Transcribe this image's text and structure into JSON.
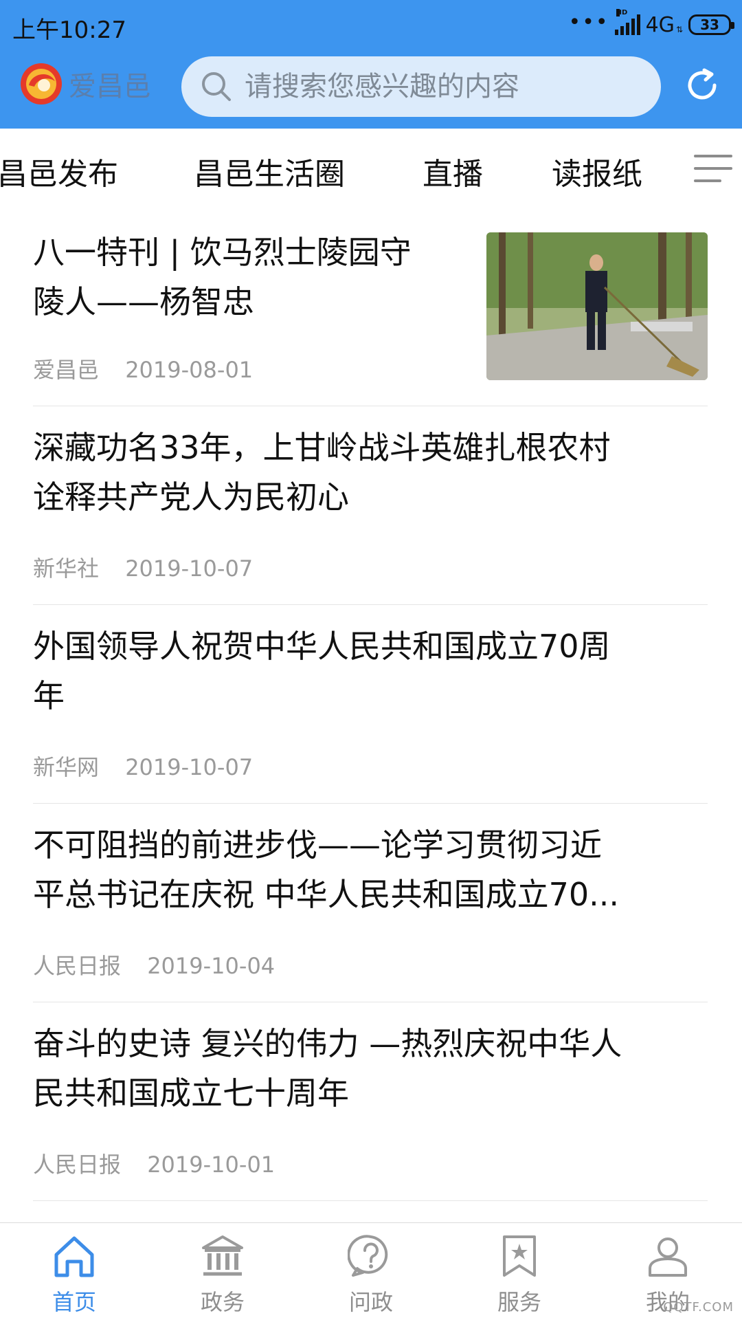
{
  "status_bar": {
    "time": "上午10:27",
    "network": "4G",
    "hd_label": "HD",
    "battery": "33"
  },
  "app_bar": {
    "logo_text": "爱昌邑",
    "search_placeholder": "请搜索您感兴趣的内容"
  },
  "tabs": [
    {
      "label": "昌邑发布"
    },
    {
      "label": "昌邑生活圈"
    },
    {
      "label": "直播"
    },
    {
      "label": "读报纸"
    }
  ],
  "news": [
    {
      "title": "八一特刊 | 饮马烈士陵园守\n陵人——杨智忠",
      "source": "爱昌邑",
      "date": "2019-08-01",
      "has_image": true
    },
    {
      "title": "深藏功名33年，上甘岭战斗英雄扎根农村\n诠释共产党人为民初心",
      "source": "新华社",
      "date": "2019-10-07",
      "has_image": false
    },
    {
      "title": "外国领导人祝贺中华人民共和国成立70周\n年",
      "source": "新华网",
      "date": "2019-10-07",
      "has_image": false
    },
    {
      "title": "不可阻挡的前进步伐——论学习贯彻习近\n平总书记在庆祝 中华人民共和国成立70...",
      "source": "人民日报",
      "date": "2019-10-04",
      "has_image": false
    },
    {
      "title": "奋斗的史诗 复兴的伟力 —热烈庆祝中华人\n民共和国成立七十周年",
      "source": "人民日报",
      "date": "2019-10-01",
      "has_image": false
    }
  ],
  "bottom_nav": [
    {
      "label": "首页",
      "icon": "home-icon",
      "active": true
    },
    {
      "label": "政务",
      "icon": "government-building-icon",
      "active": false
    },
    {
      "label": "问政",
      "icon": "question-bubble-icon",
      "active": false
    },
    {
      "label": "服务",
      "icon": "star-bookmark-icon",
      "active": false
    },
    {
      "label": "我的",
      "icon": "user-icon",
      "active": false
    }
  ],
  "watermark": "QQTF.COM",
  "colors": {
    "header_bg": "#3d95ef",
    "search_bg": "#dcebfb",
    "active_nav": "#3d8de8",
    "inactive_nav": "#8e8e8e",
    "meta_text": "#9a9a9a"
  }
}
